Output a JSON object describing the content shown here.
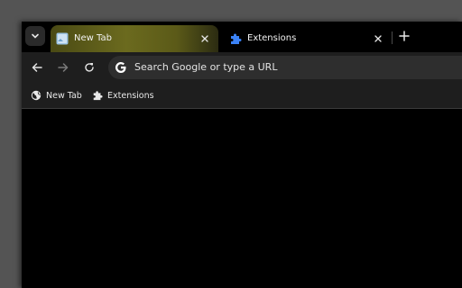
{
  "tabs": [
    {
      "title": "New Tab",
      "active": true,
      "icon": "new-tab-icon"
    },
    {
      "title": "Extensions",
      "active": false,
      "icon": "puzzle-icon"
    }
  ],
  "toolbar": {
    "back_icon": "back-arrow-icon",
    "forward_icon": "forward-arrow-icon",
    "reload_icon": "reload-icon"
  },
  "omnibox": {
    "placeholder": "Search Google or type a URL",
    "icon": "google-g-icon"
  },
  "bookmarks": [
    {
      "label": "New Tab",
      "icon": "globe-icon"
    },
    {
      "label": "Extensions",
      "icon": "puzzle-icon"
    }
  ],
  "colors": {
    "active_tab": "#6b6a1e",
    "toolbar": "#1e1e1e",
    "extension_icon": "#3b82f6"
  }
}
